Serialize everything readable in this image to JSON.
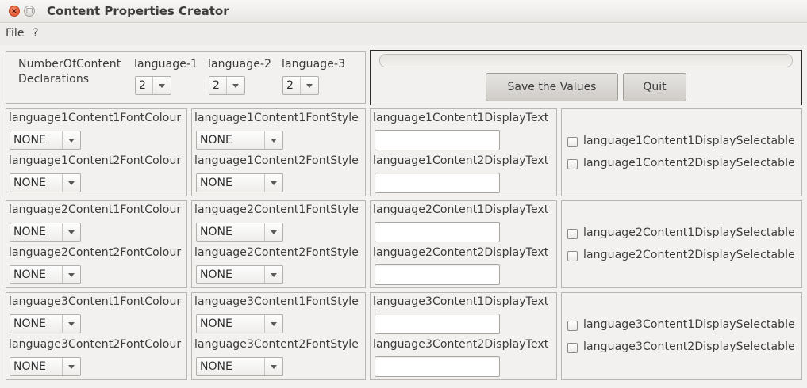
{
  "window": {
    "title": "Content Properties Creator"
  },
  "menu": [
    "File",
    "?"
  ],
  "declarations": {
    "label": "NumberOfContent\nDeclarations",
    "label_line1": "NumberOfContent",
    "label_line2": "Declarations",
    "languages": [
      {
        "label": "language-1",
        "value": "2"
      },
      {
        "label": "language-2",
        "value": "2"
      },
      {
        "label": "language-3",
        "value": "2"
      }
    ]
  },
  "actions": {
    "progress": 0,
    "save_label": "Save the Values",
    "quit_label": "Quit"
  },
  "language_rows": [
    {
      "font_colour": [
        {
          "label": "language1Content1FontColour",
          "value": "NONE"
        },
        {
          "label": "language1Content2FontColour",
          "value": "NONE"
        }
      ],
      "font_style": [
        {
          "label": "language1Content1FontStyle",
          "value": "NONE"
        },
        {
          "label": "language1Content2FontStyle",
          "value": "NONE"
        }
      ],
      "display_text": [
        {
          "label": "language1Content1DisplayText",
          "value": ""
        },
        {
          "label": "language1Content2DisplayText",
          "value": ""
        }
      ],
      "selectable": [
        {
          "label": "language1Content1DisplaySelectable",
          "checked": false
        },
        {
          "label": "language1Content2DisplaySelectable",
          "checked": false
        }
      ]
    },
    {
      "font_colour": [
        {
          "label": "language2Content1FontColour",
          "value": "NONE"
        },
        {
          "label": "language2Content2FontColour",
          "value": "NONE"
        }
      ],
      "font_style": [
        {
          "label": "language2Content1FontStyle",
          "value": "NONE"
        },
        {
          "label": "language2Content2FontStyle",
          "value": "NONE"
        }
      ],
      "display_text": [
        {
          "label": "language2Content1DisplayText",
          "value": ""
        },
        {
          "label": "language2Content2DisplayText",
          "value": ""
        }
      ],
      "selectable": [
        {
          "label": "language2Content1DisplaySelectable",
          "checked": false
        },
        {
          "label": "language2Content2DisplaySelectable",
          "checked": false
        }
      ]
    },
    {
      "font_colour": [
        {
          "label": "language3Content1FontColour",
          "value": "NONE"
        },
        {
          "label": "language3Content2FontColour",
          "value": "NONE"
        }
      ],
      "font_style": [
        {
          "label": "language3Content1FontStyle",
          "value": "NONE"
        },
        {
          "label": "language3Content2FontStyle",
          "value": "NONE"
        }
      ],
      "display_text": [
        {
          "label": "language3Content1DisplayText",
          "value": ""
        },
        {
          "label": "language3Content2DisplayText",
          "value": ""
        }
      ],
      "selectable": [
        {
          "label": "language3Content1DisplaySelectable",
          "checked": false
        },
        {
          "label": "language3Content2DisplaySelectable",
          "checked": false
        }
      ]
    }
  ],
  "colors": {
    "window_bg": "#f2f1f0",
    "close_button": "#df4a24",
    "text": "#3c3c3c"
  }
}
